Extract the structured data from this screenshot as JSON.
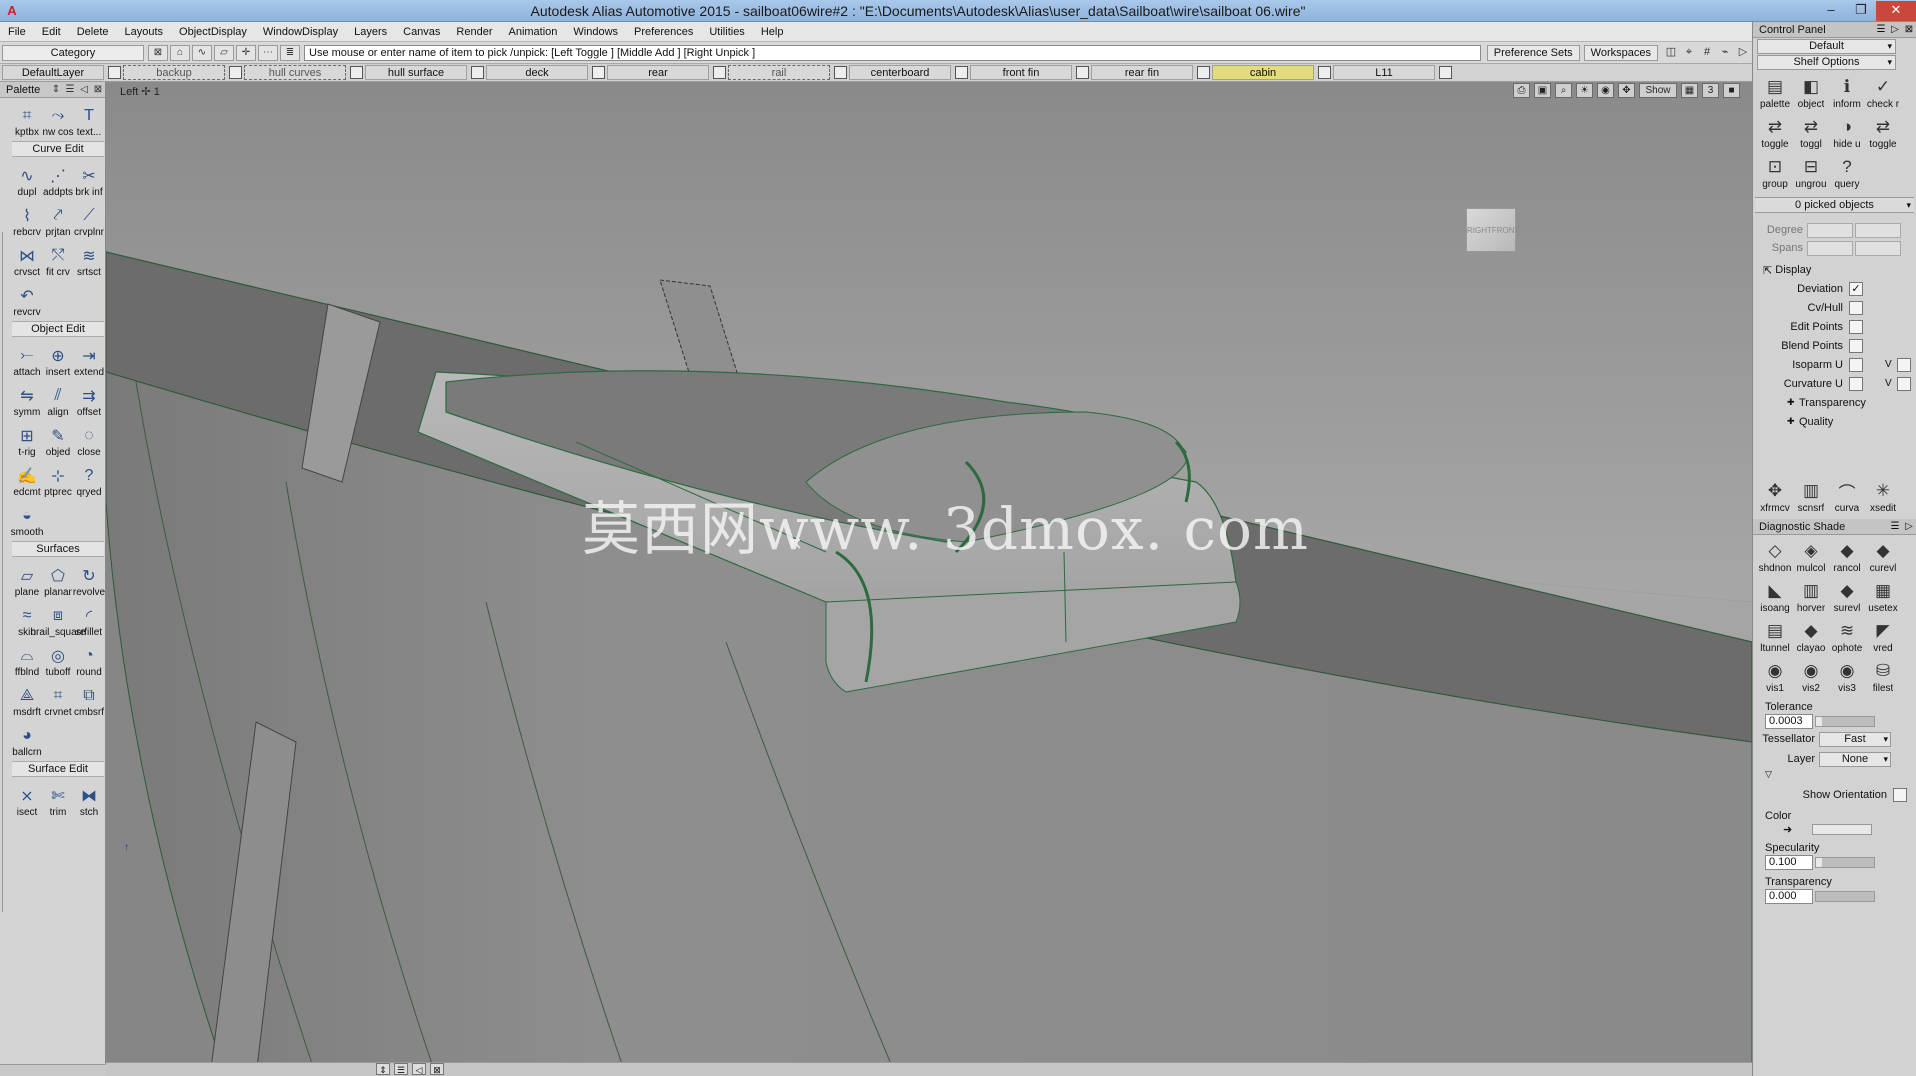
{
  "window": {
    "title": "Autodesk Alias Automotive 2015     - sailboat06wire#2 : \"E:\\Documents\\Autodesk\\Alias\\user_data\\Sailboat\\wire\\sailboat 06.wire\"",
    "app_icon": "A",
    "controls": [
      "–",
      "❐",
      "✕"
    ]
  },
  "menu": [
    "File",
    "Edit",
    "Delete",
    "Layouts",
    "ObjectDisplay",
    "WindowDisplay",
    "Layers",
    "Canvas",
    "Render",
    "Animation",
    "Windows",
    "Preferences",
    "Utilities",
    "Help"
  ],
  "prompt_row": {
    "category": "Category",
    "prompt": "Use mouse or enter name of item to pick /unpick: [Left Toggle ] [Middle Add ] [Right Unpick ]",
    "preference_sets": "Preference Sets",
    "workspaces": "Workspaces"
  },
  "layers": [
    {
      "name": "DefaultLayer",
      "style": "normal"
    },
    {
      "name": "backup",
      "style": "dashed"
    },
    {
      "name": "hull curves",
      "style": "dashed"
    },
    {
      "name": "hull surface",
      "style": "normal"
    },
    {
      "name": "deck",
      "style": "normal"
    },
    {
      "name": "rear",
      "style": "normal"
    },
    {
      "name": "rail",
      "style": "dashed"
    },
    {
      "name": "centerboard",
      "style": "normal"
    },
    {
      "name": "front fin",
      "style": "normal"
    },
    {
      "name": "rear fin",
      "style": "normal"
    },
    {
      "name": "cabin",
      "style": "active"
    },
    {
      "name": "L11",
      "style": "normal"
    }
  ],
  "viewport": {
    "label": "Left",
    "number": "1",
    "show_label": "Show",
    "watermark": "莫西网www. 3dmox. com",
    "viewcube_left": "RIGHT",
    "viewcube_right": "FRONT"
  },
  "palette": {
    "title": "Palette",
    "top_tools": [
      {
        "label": "kptbx",
        "icon": "keypoint-toolbox-icon"
      },
      {
        "label": "nw cos",
        "icon": "new-cos-icon"
      },
      {
        "label": "text...",
        "icon": "text-icon"
      }
    ],
    "sections": [
      {
        "label": "Curve Edit",
        "tools": [
          {
            "label": "dupl",
            "icon": "duplicate-curve-icon"
          },
          {
            "label": "addpts",
            "icon": "add-points-icon"
          },
          {
            "label": "brk inf",
            "icon": "break-infinite-icon"
          },
          {
            "label": "rebcrv",
            "icon": "rebuild-curve-icon"
          },
          {
            "label": "prjtan",
            "icon": "project-tangent-icon"
          },
          {
            "label": "crvplnr",
            "icon": "curve-planar-icon"
          },
          {
            "label": "crvsct",
            "icon": "curve-section-icon"
          },
          {
            "label": "fit crv",
            "icon": "fit-curve-icon"
          },
          {
            "label": "srtsct",
            "icon": "smart-section-icon"
          },
          {
            "label": "revcrv",
            "icon": "reverse-curve-icon"
          }
        ]
      },
      {
        "label": "Object Edit",
        "tools": [
          {
            "label": "attach",
            "icon": "attach-icon"
          },
          {
            "label": "insert",
            "icon": "insert-icon"
          },
          {
            "label": "extend",
            "icon": "extend-icon"
          },
          {
            "label": "symm",
            "icon": "symmetry-icon"
          },
          {
            "label": "align",
            "icon": "align-icon"
          },
          {
            "label": "offset",
            "icon": "offset-icon"
          },
          {
            "label": "t-rig",
            "icon": "transformer-rig-icon"
          },
          {
            "label": "objed",
            "icon": "object-edit-icon"
          },
          {
            "label": "close",
            "icon": "close-object-icon"
          },
          {
            "label": "edcmt",
            "icon": "edit-comment-icon"
          },
          {
            "label": "ptprec",
            "icon": "point-precision-icon"
          },
          {
            "label": "qryed",
            "icon": "query-edit-icon"
          },
          {
            "label": "smooth",
            "icon": "smooth-icon"
          }
        ]
      },
      {
        "label": "Surfaces",
        "tools": [
          {
            "label": "plane",
            "icon": "plane-icon"
          },
          {
            "label": "planar",
            "icon": "planar-surface-icon"
          },
          {
            "label": "revolve",
            "icon": "revolve-icon"
          },
          {
            "label": "skin",
            "icon": "skin-icon"
          },
          {
            "label": "brail_square",
            "icon": "birail-square-icon"
          },
          {
            "label": "srfillet",
            "icon": "surface-fillet-icon"
          },
          {
            "label": "ffblnd",
            "icon": "freeform-blend-icon"
          },
          {
            "label": "tuboff",
            "icon": "tubular-offset-icon"
          },
          {
            "label": "round",
            "icon": "round-icon"
          },
          {
            "label": "msdrft",
            "icon": "multi-surface-draft-icon"
          },
          {
            "label": "crvnet",
            "icon": "curve-network-icon"
          },
          {
            "label": "cmbsrf",
            "icon": "combine-surface-icon"
          },
          {
            "label": "ballcrn",
            "icon": "ball-corner-icon"
          }
        ]
      },
      {
        "label": "Surface Edit",
        "tools": [
          {
            "label": "isect",
            "icon": "intersect-icon"
          },
          {
            "label": "trim",
            "icon": "trim-icon"
          },
          {
            "label": "stch",
            "icon": "stitch-icon"
          }
        ]
      }
    ]
  },
  "control_panel": {
    "title": "Control Panel",
    "preset": "Default",
    "shelf_options": "Shelf Options",
    "shelf_tools": [
      {
        "label": "palette",
        "icon": "palette-icon"
      },
      {
        "label": "object",
        "icon": "object-icon"
      },
      {
        "label": "inform",
        "icon": "information-icon"
      },
      {
        "label": "check r",
        "icon": "check-icon"
      },
      {
        "label": "toggle",
        "icon": "toggle-icon"
      },
      {
        "label": "toggl",
        "icon": "toggle-icon"
      },
      {
        "label": "hide u",
        "icon": "hide-unselected-icon"
      },
      {
        "label": "toggle",
        "icon": "toggle-icon"
      },
      {
        "label": "group",
        "icon": "group-icon"
      },
      {
        "label": "ungrou",
        "icon": "ungroup-icon"
      },
      {
        "label": "query",
        "icon": "query-icon"
      }
    ],
    "picked_objects": "0 picked objects",
    "degree_label": "Degree",
    "spans_label": "Spans",
    "display_label": "Display",
    "display_checks": [
      {
        "label": "Deviation",
        "checked": true,
        "has_v": false
      },
      {
        "label": "Cv/Hull",
        "checked": false,
        "has_v": false
      },
      {
        "label": "Edit Points",
        "checked": false,
        "has_v": false
      },
      {
        "label": "Blend Points",
        "checked": false,
        "has_v": false
      },
      {
        "label": "Isoparm U",
        "checked": false,
        "has_v": true
      },
      {
        "label": "Curvature U",
        "checked": false,
        "has_v": true
      }
    ],
    "v_label": "V",
    "subsections": [
      "Transparency",
      "Quality"
    ],
    "eval_tools": [
      {
        "label": "xfrmcv",
        "icon": "transform-cv-icon"
      },
      {
        "label": "scnsrf",
        "icon": "scan-surface-icon"
      },
      {
        "label": "curva",
        "icon": "curvature-icon"
      },
      {
        "label": "xsedit",
        "icon": "cross-section-edit-icon"
      }
    ]
  },
  "diagnostic_shade": {
    "title": "Diagnostic Shade",
    "tools": [
      {
        "label": "shdnon",
        "icon": "shade-none-icon"
      },
      {
        "label": "mulcol",
        "icon": "multi-color-icon"
      },
      {
        "label": "rancol",
        "icon": "random-color-icon"
      },
      {
        "label": "curevl",
        "icon": "curvature-eval-icon"
      },
      {
        "label": "isoang",
        "icon": "isoangle-icon"
      },
      {
        "label": "horver",
        "icon": "horizontal-vertical-icon"
      },
      {
        "label": "surevl",
        "icon": "surface-eval-icon"
      },
      {
        "label": "usetex",
        "icon": "use-texture-icon"
      },
      {
        "label": "ltunnel",
        "icon": "light-tunnel-icon"
      },
      {
        "label": "clayao",
        "icon": "clay-ao-icon"
      },
      {
        "label": "ophote",
        "icon": "isophote-icon"
      },
      {
        "label": "vred",
        "icon": "vred-icon"
      },
      {
        "label": "vis1",
        "icon": "visual-1-icon"
      },
      {
        "label": "vis2",
        "icon": "visual-2-icon"
      },
      {
        "label": "vis3",
        "icon": "visual-3-icon"
      },
      {
        "label": "filest",
        "icon": "file-style-icon"
      }
    ],
    "tolerance_label": "Tolerance",
    "tolerance_value": "0.0003",
    "tessellator_label": "Tessellator",
    "tessellator_value": "Fast",
    "layer_label": "Layer",
    "layer_value": "None",
    "show_orientation_label": "Show Orientation",
    "color_label": "Color",
    "specularity_label": "Specularity",
    "specularity_value": "0.100",
    "transparency_label": "Transparency",
    "transparency_value": "0.000"
  }
}
